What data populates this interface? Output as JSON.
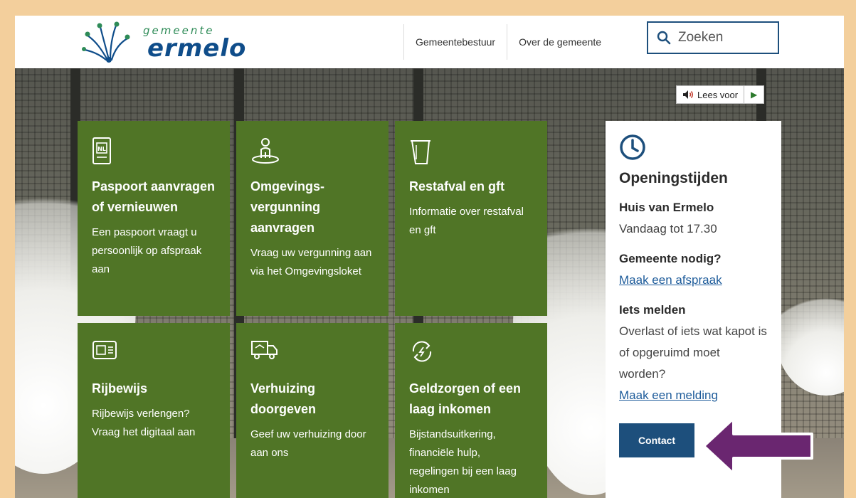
{
  "brand": {
    "small": "gemeente",
    "big": "ermelo"
  },
  "nav": {
    "items": [
      {
        "label": "Gemeentebestuur"
      },
      {
        "label": "Over de gemeente"
      }
    ]
  },
  "search": {
    "placeholder": "Zoeken"
  },
  "read_aloud": {
    "label": "Lees voor"
  },
  "tiles": [
    {
      "icon": "passport-icon",
      "title": "Paspoort aanvragen of vernieuwen",
      "description": "Een paspoort vraagt u persoonlijk op afspraak aan"
    },
    {
      "icon": "location-person-icon",
      "title": "Omgevings-vergunning aanvragen",
      "description": "Vraag uw vergunning aan via het Omgevingsloket"
    },
    {
      "icon": "waste-bin-icon",
      "title": "Restafval en gft",
      "description": "Informatie over restafval en gft"
    },
    {
      "icon": "driving-license-icon",
      "title": "Rijbewijs",
      "description": "Rijbewijs verlengen? Vraag het digitaal aan"
    },
    {
      "icon": "moving-truck-icon",
      "title": "Verhuizing doorgeven",
      "description": "Geef uw verhuizing door aan ons"
    },
    {
      "icon": "money-cycle-icon",
      "title": "Geldzorgen of een laag inkomen",
      "description": "Bijstandsuitkering, financiële hulp, regelingen bij een laag inkomen"
    }
  ],
  "hours": {
    "icon": "clock-icon",
    "title": "Openingstijden",
    "location": "Huis van Ermelo",
    "today": "Vandaag tot 17.30",
    "need_heading": "Gemeente nodig?",
    "appointment_link": "Maak een afspraak",
    "report_heading": "Iets melden",
    "report_text": "Overlast of iets wat kapot is of opgeruimd moet worden?",
    "report_link": "Maak een melding",
    "contact_button": "Contact"
  },
  "colors": {
    "tile": "#507526",
    "primary": "#1d4f7c",
    "link": "#1d5b9a",
    "arrow": "#6a2670",
    "frame": "#f3cf9c"
  }
}
